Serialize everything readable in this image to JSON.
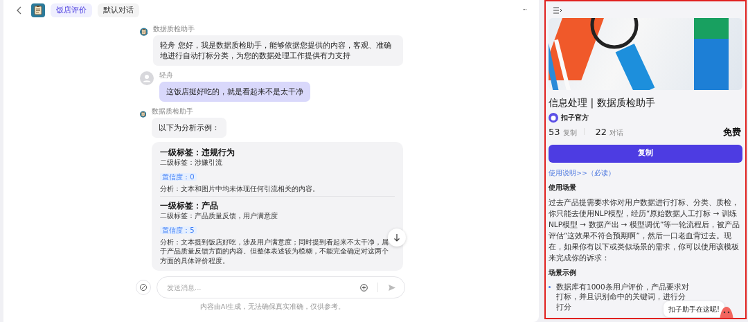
{
  "header": {
    "tabs": [
      {
        "label": "饭店评价",
        "selected": true
      },
      {
        "label": "默认对话",
        "selected": false
      }
    ],
    "more": "···"
  },
  "messages": [
    {
      "kind": "bot",
      "sender": "数据质检助手",
      "text": "轻舟 您好，我是数据质检助手，能够依据您提供的内容，客观、准确地进行自动打标分类，为您的数据处理工作提供有力支持"
    },
    {
      "kind": "user",
      "sender": "轻舟",
      "text": "这饭店挺好吃的，就是看起来不是太干净"
    },
    {
      "kind": "bot",
      "sender": "数据质检助手",
      "text": "以下为分析示例：",
      "results": [
        {
          "primary": "一级标签：违规行为",
          "secondary": "二级标签：涉嫌引流",
          "confidence": "置信度：0",
          "analysis": "分析：文本和图片中均未体现任何引流相关的内容。"
        },
        {
          "primary": "一级标签：产品",
          "secondary": "二级标签：产品质量反馈，用户满意度",
          "confidence": "置信度：5",
          "analysis": "分析：文本提到饭店好吃，涉及用户满意度；同时提到看起来不太干净，属于产品质量反馈方面的内容。但整体表述较为模糊，不能完全确定对这两个方面的具体评价程度。"
        }
      ]
    }
  ],
  "composer": {
    "placeholder": "发送消息..."
  },
  "disclaimer": "内容由AI生成，无法确保真实准确，仅供参考。",
  "panel": {
    "title": "信息处理 | 数据质检助手",
    "author": "扣子官方",
    "stats": [
      {
        "value": "53",
        "label": "复制"
      },
      {
        "value": "22",
        "label": "对话"
      }
    ],
    "price": "免费",
    "button": "复制",
    "link": "使用说明>>（必读）",
    "sections": [
      {
        "kind": "heading",
        "text": "使用场景"
      },
      {
        "kind": "paragraph",
        "text": "过去产品提需要求你对用户数据进行打标、分类、质检，你只能去使用NLP模型，经历“原始数据人工打标 → 训练NLP模型 → 数据产出 → 模型调优”等一轮流程后，被产品评估“这效果不符合预期啊”，然后一口老血背过去。现在，如果你有以下或类似场景的需求，你可以使用该模板来完成你的诉求："
      },
      {
        "kind": "heading",
        "text": "场景示例"
      },
      {
        "kind": "bullet",
        "lines": [
          "数据库有1000条用户评价，产品要求对",
          "打标，并且识别命中的关键词，进行分",
          "打分"
        ]
      }
    ],
    "tooltip": "扣子助手在这呢!"
  }
}
